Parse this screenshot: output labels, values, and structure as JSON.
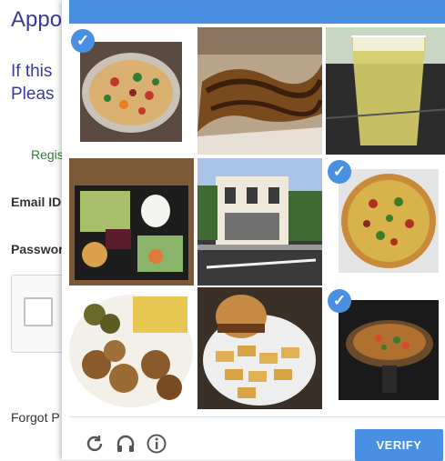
{
  "background_page": {
    "title": "Appo",
    "line1": "If this",
    "line2": "Pleas",
    "register_link": "Regis",
    "email_label": "Email ID",
    "password_label": "Passwor",
    "forgot_link": "Forgot P"
  },
  "captcha": {
    "tiles": [
      {
        "name": "pizza-on-pan",
        "selected": true
      },
      {
        "name": "chocolate-drizzled-dessert",
        "selected": false
      },
      {
        "name": "glass-of-beer",
        "selected": false
      },
      {
        "name": "bento-box",
        "selected": false
      },
      {
        "name": "street-building",
        "selected": false
      },
      {
        "name": "whole-pizza",
        "selected": true
      },
      {
        "name": "fried-food-plate",
        "selected": false
      },
      {
        "name": "burger-and-chips",
        "selected": false
      },
      {
        "name": "pizza-on-board",
        "selected": true
      }
    ],
    "footer": {
      "reload_icon": "reload-icon",
      "audio_icon": "headphones-icon",
      "info_icon": "info-icon",
      "verify_label": "VERIFY"
    },
    "accent_color": "#4a90e2"
  }
}
